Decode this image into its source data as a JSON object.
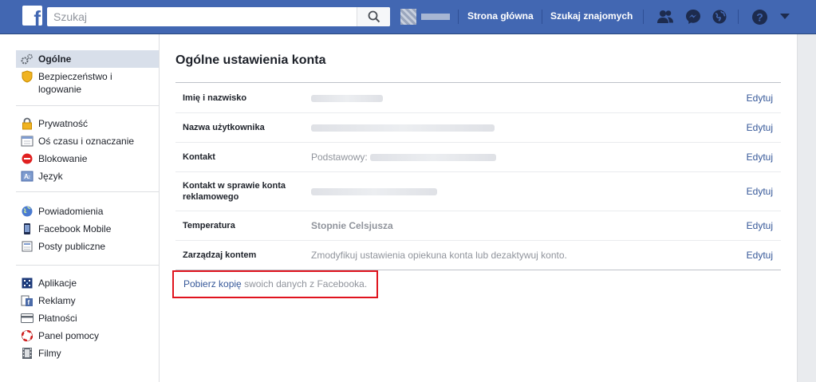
{
  "topbar": {
    "search_placeholder": "Szukaj",
    "nav_home": "Strona główna",
    "nav_find_friends": "Szukaj znajomych",
    "accent_color": "#4267b2"
  },
  "sidebar": {
    "groups": [
      [
        {
          "label": "Ogólne",
          "icon": "gear-icon",
          "active": true
        },
        {
          "label": "Bezpieczeństwo i logowanie",
          "icon": "shield-icon"
        }
      ],
      [
        {
          "label": "Prywatność",
          "icon": "lock-icon"
        },
        {
          "label": "Oś czasu i oznaczanie",
          "icon": "timeline-icon"
        },
        {
          "label": "Blokowanie",
          "icon": "block-icon"
        },
        {
          "label": "Język",
          "icon": "language-icon"
        }
      ],
      [
        {
          "label": "Powiadomienia",
          "icon": "globe-icon"
        },
        {
          "label": "Facebook Mobile",
          "icon": "mobile-icon"
        },
        {
          "label": "Posty publiczne",
          "icon": "rss-icon"
        }
      ],
      [
        {
          "label": "Aplikacje",
          "icon": "apps-icon"
        },
        {
          "label": "Reklamy",
          "icon": "ads-icon"
        },
        {
          "label": "Płatności",
          "icon": "card-icon"
        },
        {
          "label": "Panel pomocy",
          "icon": "lifebuoy-icon"
        },
        {
          "label": "Filmy",
          "icon": "film-icon"
        }
      ]
    ]
  },
  "main": {
    "title": "Ogólne ustawienia konta",
    "edit_label": "Edytuj",
    "rows": [
      {
        "label": "Imię i nazwisko"
      },
      {
        "label": "Nazwa użytkownika"
      },
      {
        "label": "Kontakt",
        "prefix": "Podstawowy:"
      },
      {
        "label": "Kontakt w sprawie konta reklamowego"
      },
      {
        "label": "Temperatura",
        "value": "Stopnie Celsjusza"
      },
      {
        "label": "Zarządzaj kontem",
        "value": "Zmodyfikuj ustawienia opiekuna konta lub dezaktywuj konto."
      }
    ],
    "download_link": "Pobierz kopię",
    "download_rest": "swoich danych z Facebooka.",
    "highlight_color": "#e0141e"
  }
}
